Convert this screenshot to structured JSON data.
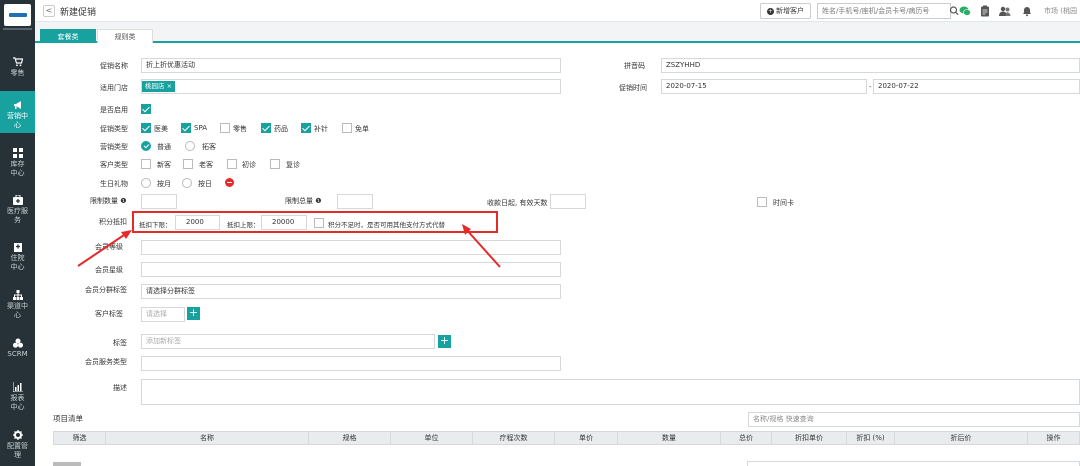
{
  "sidebar": {
    "items": [
      {
        "label": "零售",
        "icon": "cart-icon",
        "active": false
      },
      {
        "label": "营销中心",
        "icon": "megaphone-icon",
        "active": true
      },
      {
        "label": "库存中心",
        "icon": "grid-icon",
        "active": false
      },
      {
        "label": "医疗服务",
        "icon": "medkit-icon",
        "active": false
      },
      {
        "label": "住院中心",
        "icon": "hospital-icon",
        "active": false
      },
      {
        "label": "渠道中心",
        "icon": "sitemap-icon",
        "active": false
      },
      {
        "label": "SCRM",
        "icon": "cubes-icon",
        "active": false
      },
      {
        "label": "报表中心",
        "icon": "bar-chart-icon",
        "active": false
      },
      {
        "label": "配置管理",
        "icon": "gear-icon",
        "active": false
      }
    ]
  },
  "header": {
    "back": "<",
    "title": "新建促销",
    "add_customer": "新增客户",
    "search_placeholder": "姓名/手机号/座机/会员卡号/病历号",
    "user_text": "市场 (桃园"
  },
  "tabs": [
    "套餐类",
    "规则类"
  ],
  "form": {
    "promo_name_label": "促销名称",
    "promo_name_value": "折上折优惠活动",
    "pinyin_label": "拼音码",
    "pinyin_value": "ZSZYHHD",
    "store_label": "适用门店",
    "store_tag": "桃园店",
    "promo_time_label": "促销时间",
    "start_date": "2020-07-15",
    "date_sep": "-",
    "end_date": "2020-07-22",
    "enabled_label": "是否启用",
    "promo_type_label": "促销类型",
    "promo_types": [
      {
        "label": "医美",
        "checked": true
      },
      {
        "label": "SPA",
        "checked": true
      },
      {
        "label": "零售",
        "checked": false
      },
      {
        "label": "药品",
        "checked": true
      },
      {
        "label": "补针",
        "checked": true
      },
      {
        "label": "免单",
        "checked": false
      }
    ],
    "sale_type_label": "营销类型",
    "sale_types": [
      {
        "label": "普通",
        "checked": true
      },
      {
        "label": "拓客",
        "checked": false
      }
    ],
    "customer_type_label": "客户类型",
    "customer_types": [
      "新客",
      "老客",
      "初诊",
      "复诊"
    ],
    "birthday_label": "生日礼物",
    "birthday_opts": [
      "按月",
      "按日"
    ],
    "limit_qty_label": "限制数量",
    "limit_total_label": "限制总量",
    "valid_days_label": "收款日起, 有效天数",
    "time_card_label": "时间卡",
    "points_label": "积分抵扣",
    "deduct_min_label": "抵扣下限：",
    "deduct_min_value": "2000",
    "deduct_max_label": "抵扣上限：",
    "deduct_max_value": "20000",
    "points_note": "积分不足时，是否可用其他支付方式代替",
    "member_level_label": "会员等级",
    "member_star_label": "会员星级",
    "member_group_label": "会员分群标签",
    "member_group_placeholder": "请选择分群标签",
    "customer_tag_label": "客户标签",
    "customer_tag_placeholder": "请选择",
    "tag_label": "标签",
    "tag_placeholder": "添加新标签",
    "member_service_label": "会员服务类型",
    "desc_label": "描述"
  },
  "items": {
    "title": "项目清单",
    "quick_search": "名称/规格 快速查询",
    "columns": [
      "筛选",
      "名称",
      "规格",
      "单位",
      "疗程次数",
      "单价",
      "数量",
      "总价",
      "折扣单价",
      "折扣 (%)",
      "折后价",
      "操作"
    ]
  },
  "colors": {
    "accent": "#17a2a0",
    "sidebar": "#263238",
    "annotation": "#e52a2a"
  }
}
